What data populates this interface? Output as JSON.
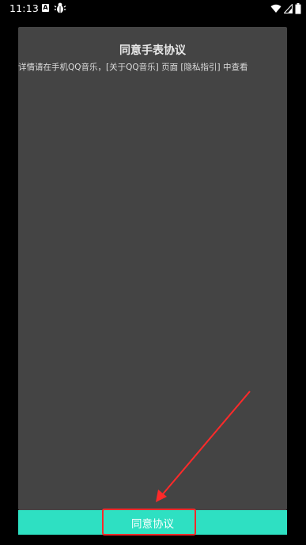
{
  "status_bar": {
    "time": "11:13",
    "notification_letter": "A"
  },
  "dialog": {
    "title": "同意手表协议",
    "body": "详情请在手机QQ音乐，[关于QQ音乐] 页面 [隐私指引] 中查看"
  },
  "agree_button": {
    "label": "同意协议"
  },
  "colors": {
    "background": "#000000",
    "dialog_bg": "#444444",
    "button_accent": "#2ee0c2",
    "annotation_red": "#ff2a2a"
  },
  "icons": {
    "status_left": [
      "a-notification-icon",
      "bug-icon"
    ],
    "status_right": [
      "wifi-icon",
      "signal-icon",
      "battery-icon"
    ]
  }
}
